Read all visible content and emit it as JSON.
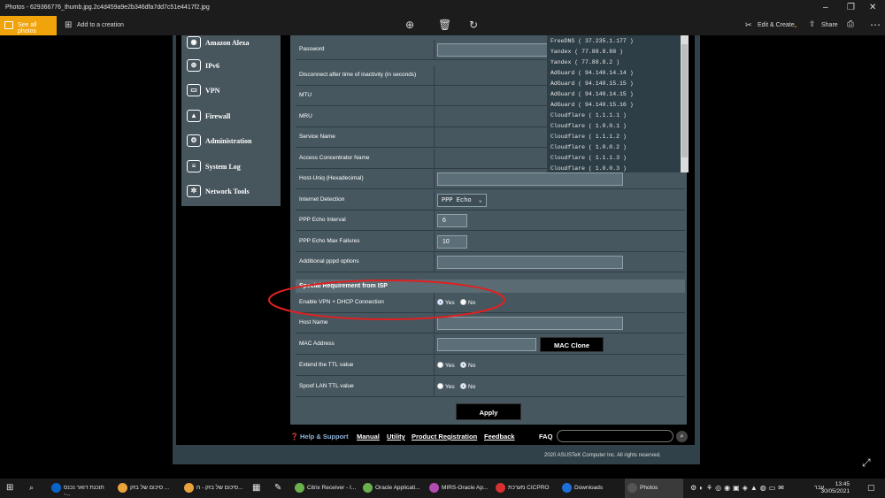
{
  "window": {
    "title": "Photos - 629366776_thumb.jpg.2c4d459a9e2b346dfa7dd7c51e4417f2.jpg"
  },
  "toolbar": {
    "see_all_photos": "See all photos",
    "add_to_creation": "Add to a creation",
    "edit_create": "Edit & Create",
    "share": "Share"
  },
  "router": {
    "menu": [
      "Amazon Alexa",
      "IPv6",
      "VPN",
      "Firewall",
      "Administration",
      "System Log",
      "Network Tools"
    ],
    "rows": {
      "password": "Password",
      "disconnect": "Disconnect after time of inactivity (in seconds)",
      "mtu": "MTU",
      "mru": "MRU",
      "service_name": "Service Name",
      "access_concentrator": "Access Concentrator Name",
      "host_uniq": "Host-Uniq (Hexadecimal)",
      "internet_detection": "Internet Detection",
      "internet_detection_value": "PPP Echo",
      "ppp_echo_interval": "PPP Echo Interval",
      "ppp_echo_interval_value": "6",
      "ppp_echo_max": "PPP Echo Max Failures",
      "ppp_echo_max_value": "10",
      "additional_pppd": "Additional pppd options",
      "section_title": "Special Requirement from ISP",
      "enable_vpn_dhcp": "Enable VPN + DHCP Connection",
      "host_name": "Host Name",
      "mac_address": "MAC Address",
      "mac_clone": "MAC Clone",
      "extend_ttl": "Extend the TTL value",
      "spoof_ttl": "Spoof LAN TTL value",
      "yes": "Yes",
      "no": "No",
      "apply": "Apply"
    },
    "dns_list": [
      "FreeDNS ( 37.235.1.177 )",
      "Yandex ( 77.88.8.88 )",
      "Yandex ( 77.88.8.2 )",
      "AdGuard ( 94.140.14.14 )",
      "AdGuard ( 94.140.15.15 )",
      "AdGuard ( 94.140.14.15 )",
      "AdGuard ( 94.140.15.16 )",
      "Cloudflare ( 1.1.1.1 )",
      "Cloudflare ( 1.0.0.1 )",
      "Cloudflare ( 1.1.1.2 )",
      "Cloudflare ( 1.0.0.2 )",
      "Cloudflare ( 1.1.1.3 )",
      "Cloudflare ( 1.0.0.3 )"
    ],
    "footer": {
      "help": "Help & Support",
      "manual": "Manual",
      "utility": "Utility",
      "product_registration": "Product Registration",
      "feedback": "Feedback",
      "faq": "FAQ",
      "copyright": "2020 ASUSTeK Computer Inc. All rights reserved."
    }
  },
  "taskbar": {
    "tasks": [
      {
        "label": "תוכנת דואר נכנס -...",
        "color": "#0a64c8"
      },
      {
        "label": "סיכום של בזק ...",
        "color": "#e8a33c"
      },
      {
        "label": "סיכום של בזק - ח...",
        "color": "#e8a33c"
      },
      {
        "label": "Citrix Receiver - I...",
        "color": "#6ab04c"
      },
      {
        "label": "Oracle Applicati...",
        "color": "#6ab04c"
      },
      {
        "label": "MIRS-Oracle Ap...",
        "color": "#b04cb0"
      },
      {
        "label": "מערכת CICPRO",
        "color": "#d63030"
      },
      {
        "label": "Downloads",
        "color": "#1f6fd8"
      },
      {
        "label": "Photos",
        "color": "#555"
      }
    ],
    "time": "13:45",
    "date": "30/05/2021",
    "lang": "עבר"
  }
}
